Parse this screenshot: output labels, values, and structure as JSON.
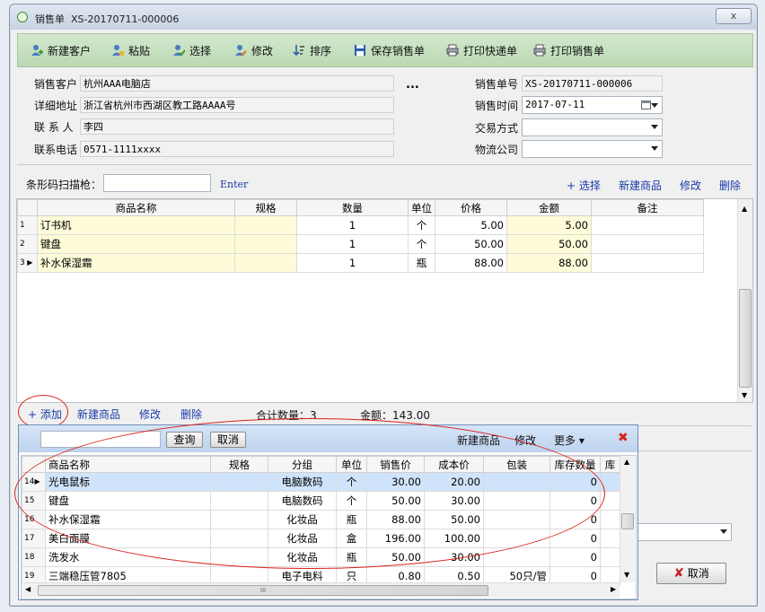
{
  "window": {
    "title": "销售单  XS-20170711-000006",
    "close_label": "x"
  },
  "toolbar": [
    {
      "label": "新建客户",
      "icon": "new-customer-icon"
    },
    {
      "label": "粘贴",
      "icon": "paste-icon"
    },
    {
      "label": "选择",
      "icon": "select-icon"
    },
    {
      "label": "修改",
      "icon": "edit-icon"
    },
    {
      "label": "排序",
      "icon": "sort-icon"
    },
    {
      "label": "保存销售单",
      "icon": "save-icon"
    },
    {
      "label": "打印快递单",
      "icon": "print-icon"
    },
    {
      "label": "打印销售单",
      "icon": "print-icon"
    }
  ],
  "form": {
    "customer_label": "销售客户",
    "customer": "杭州AAA电脑店",
    "address_label": "详细地址",
    "address": "浙江省杭州市西湖区教工路AAAA号",
    "contact_label": "联 系 人",
    "contact": "李四",
    "phone_label": "联系电话",
    "phone": "0571-1111xxxx",
    "ellipsis": "...",
    "order_no_label": "销售单号",
    "order_no": "XS-20170711-000006",
    "date_label": "销售时间",
    "date": "2017-07-11",
    "trade_label": "交易方式",
    "trade": "",
    "logistics_label": "物流公司",
    "logistics": ""
  },
  "barcode": {
    "label": "条形码扫描枪：",
    "value": "",
    "enter": "Enter"
  },
  "item_actions": {
    "select": "+ 选择",
    "new": "新建商品",
    "edit": "修改",
    "delete": "删除"
  },
  "items_table": {
    "headers": [
      "商品名称",
      "规格",
      "数量",
      "单位",
      "价格",
      "金额",
      "备注"
    ],
    "rows": [
      {
        "no": "1",
        "name": "订书机",
        "spec": "",
        "qty": "1",
        "unit": "个",
        "price": "5.00",
        "amount": "5.00",
        "note": ""
      },
      {
        "no": "2",
        "name": "键盘",
        "spec": "",
        "qty": "1",
        "unit": "个",
        "price": "50.00",
        "amount": "50.00",
        "note": ""
      },
      {
        "no": "3",
        "name": "补水保湿霜",
        "spec": "",
        "qty": "1",
        "unit": "瓶",
        "price": "88.00",
        "amount": "88.00",
        "note": ""
      }
    ]
  },
  "footer": {
    "add": "+ 添加",
    "new": "新建商品",
    "edit": "修改",
    "delete": "删除",
    "total_qty": "合计数量：3",
    "total_amount": "金额：143.00"
  },
  "popup": {
    "search_value": "",
    "search_btn": "查询",
    "cancel_btn": "取消",
    "new": "新建商品",
    "edit": "修改",
    "more": "更多 ▾",
    "close": "✖",
    "headers": [
      "商品名称",
      "规格",
      "分组",
      "单位",
      "销售价",
      "成本价",
      "包装",
      "库存数量",
      "库"
    ],
    "rows": [
      {
        "no": "14",
        "name": "光电鼠标",
        "spec": "",
        "group": "电脑数码",
        "unit": "个",
        "price": "30.00",
        "cost": "20.00",
        "pack": "",
        "stock": "0"
      },
      {
        "no": "15",
        "name": "键盘",
        "spec": "",
        "group": "电脑数码",
        "unit": "个",
        "price": "50.00",
        "cost": "30.00",
        "pack": "",
        "stock": "0"
      },
      {
        "no": "16",
        "name": "补水保湿霜",
        "spec": "",
        "group": "化妆品",
        "unit": "瓶",
        "price": "88.00",
        "cost": "50.00",
        "pack": "",
        "stock": "0"
      },
      {
        "no": "17",
        "name": "美白面膜",
        "spec": "",
        "group": "化妆品",
        "unit": "盒",
        "price": "196.00",
        "cost": "100.00",
        "pack": "",
        "stock": "0"
      },
      {
        "no": "18",
        "name": "洗发水",
        "spec": "",
        "group": "化妆品",
        "unit": "瓶",
        "price": "50.00",
        "cost": "30.00",
        "pack": "",
        "stock": "0"
      },
      {
        "no": "19",
        "name": "三端稳压管7805",
        "spec": "",
        "group": "电子电料",
        "unit": "只",
        "price": "0.80",
        "cost": "0.50",
        "pack": "50只/管",
        "stock": "0"
      }
    ],
    "hscroll_grip": "III"
  },
  "cancel_main": "取消",
  "colors": {
    "toolbar": "#c6e0c0",
    "highlight": "#fdfbd8",
    "selection": "#cfe3fa",
    "annotation": "#d9241c",
    "link": "#1a3aa8"
  }
}
